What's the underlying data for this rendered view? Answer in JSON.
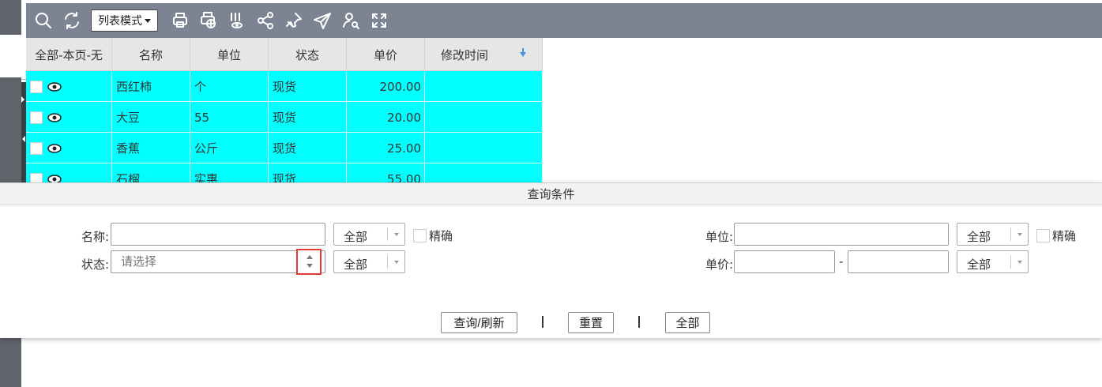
{
  "toolbar": {
    "mode_label": "列表模式",
    "icons": [
      "search-icon",
      "refresh-icon",
      "print-icon",
      "print-add-icon",
      "column-view-icon",
      "share-icon",
      "pin-icon",
      "send-icon",
      "user-search-icon",
      "fullscreen-icon"
    ]
  },
  "grid": {
    "headers": [
      "全部-本页-无",
      "名称",
      "单位",
      "状态",
      "单价",
      "修改时间"
    ],
    "rows": [
      {
        "name": "西红柿",
        "unit": "个",
        "status": "现货",
        "price": "200.00",
        "modified": ""
      },
      {
        "name": "大豆",
        "unit": "55",
        "status": "现货",
        "price": "20.00",
        "modified": ""
      },
      {
        "name": "香蕉",
        "unit": "公斤",
        "status": "现货",
        "price": "25.00",
        "modified": ""
      },
      {
        "name": "石榴",
        "unit": "实惠",
        "status": "现货",
        "price": "55.00",
        "modified": ""
      }
    ],
    "row_color": "#00ffff"
  },
  "query": {
    "title": "查询条件",
    "name_label": "名称:",
    "name_value": "",
    "name_scope": "全部",
    "exact_label": "精确",
    "status_label": "状态:",
    "status_placeholder": "请选择",
    "status_scope": "全部",
    "unit_label": "单位:",
    "unit_value": "",
    "unit_scope": "全部",
    "unit_exact_label": "精确",
    "price_label": "单价:",
    "price_from": "",
    "price_to": "",
    "price_range_sep": "-",
    "price_scope": "全部",
    "buttons": {
      "query": "查询/刷新",
      "reset": "重置",
      "all": "全部"
    },
    "separator": "|"
  },
  "colors": {
    "toolbar_bg": "#7c8494",
    "highlight_border": "#e53935"
  }
}
